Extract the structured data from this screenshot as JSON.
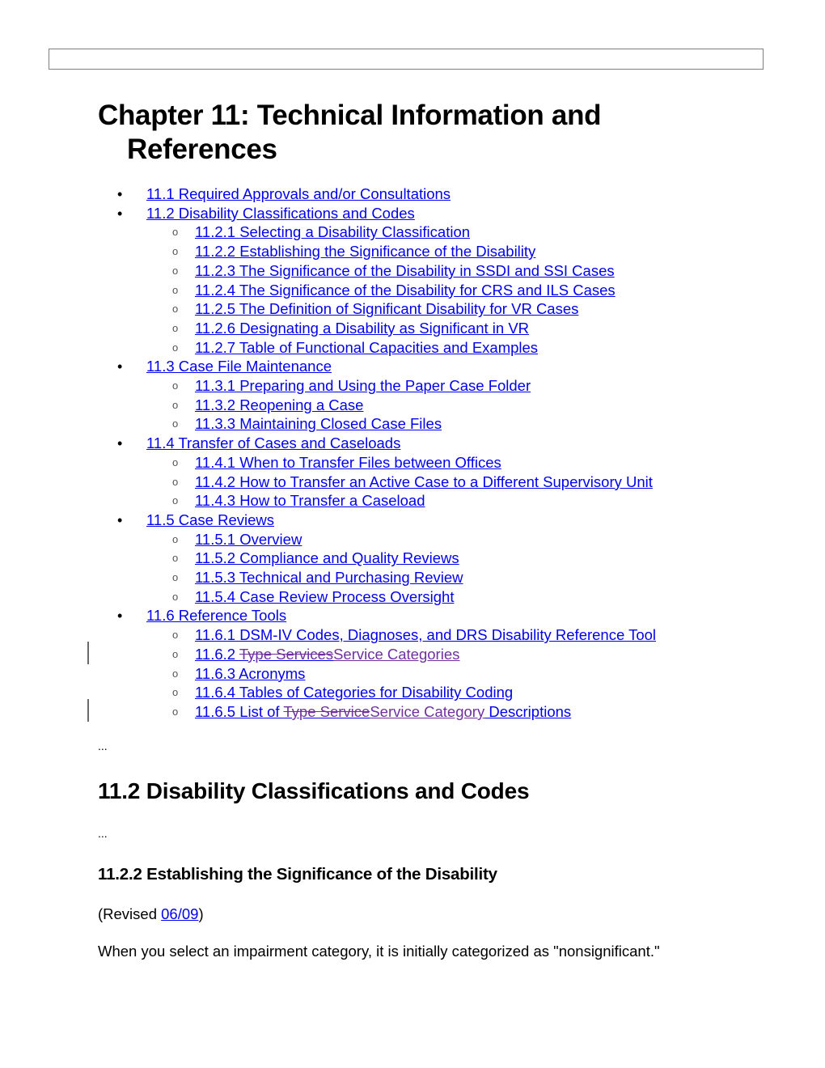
{
  "document": {
    "chapter_title": "Chapter 11: Technical Information and References",
    "toc": [
      {
        "level": 1,
        "label": "11.1 Required Approvals and/or Consultations"
      },
      {
        "level": 1,
        "label": "11.2 Disability Classifications and Codes"
      },
      {
        "level": 2,
        "label": "11.2.1 Selecting a Disability Classification"
      },
      {
        "level": 2,
        "label": "11.2.2 Establishing the Significance of the Disability"
      },
      {
        "level": 2,
        "label": "11.2.3 The Significance of the Disability in SSDI and SSI Cases"
      },
      {
        "level": 2,
        "label": "11.2.4 The Significance of the Disability for CRS and ILS Cases"
      },
      {
        "level": 2,
        "label": "11.2.5 The Definition of Significant Disability for VR Cases"
      },
      {
        "level": 2,
        "label": "11.2.6 Designating a Disability as Significant in VR"
      },
      {
        "level": 2,
        "label": "11.2.7 Table of Functional Capacities and Examples"
      },
      {
        "level": 1,
        "label": "11.3 Case File Maintenance"
      },
      {
        "level": 2,
        "label": "11.3.1 Preparing and Using the Paper Case Folder"
      },
      {
        "level": 2,
        "label": "11.3.2 Reopening a Case"
      },
      {
        "level": 2,
        "label": "11.3.3 Maintaining Closed Case Files"
      },
      {
        "level": 1,
        "label": "11.4 Transfer of Cases and Caseloads"
      },
      {
        "level": 2,
        "label": "11.4.1 When to Transfer Files between Offices"
      },
      {
        "level": 2,
        "label": "11.4.2 How to Transfer an Active Case to a Different Supervisory Unit"
      },
      {
        "level": 2,
        "label": "11.4.3 How to Transfer a Caseload"
      },
      {
        "level": 1,
        "label": "11.5 Case Reviews"
      },
      {
        "level": 2,
        "label": "11.5.1 Overview"
      },
      {
        "level": 2,
        "label": "11.5.2 Compliance and Quality Reviews"
      },
      {
        "level": 2,
        "label": "11.5.3 Technical and Purchasing Review"
      },
      {
        "level": 2,
        "label": "11.5.4 Case Review Process Oversight"
      },
      {
        "level": 1,
        "label": "11.6 Reference Tools"
      },
      {
        "level": 2,
        "label": "11.6.1 DSM-IV Codes, Diagnoses, and DRS Disability Reference Tool"
      },
      {
        "level": 2,
        "tracked": true,
        "prefix": "11.6.2 ",
        "deleted": "Type Services",
        "inserted": "Service Categories",
        "suffix": ""
      },
      {
        "level": 2,
        "label": "11.6.3 Acronyms"
      },
      {
        "level": 2,
        "label": "11.6.4 Tables of Categories for Disability Coding"
      },
      {
        "level": 2,
        "tracked": true,
        "prefix": "11.6.5 List of ",
        "deleted": "Type Service",
        "inserted": "Service Category",
        "suffix": " Descriptions"
      }
    ],
    "ellipsis_1": "...",
    "section_heading": "11.2 Disability Classifications and Codes",
    "ellipsis_2": "...",
    "subsection_heading": "11.2.2 Establishing the Significance of the Disability",
    "revised_prefix": "(Revised ",
    "revised_link": "06/09",
    "revised_suffix": ")",
    "body_text": "When you select an impairment category, it is initially categorized as \"nonsignificant.\""
  },
  "colors": {
    "link": "#0000ee",
    "tracked_change": "#7030a0",
    "change_bar": "#6a6a6a"
  }
}
